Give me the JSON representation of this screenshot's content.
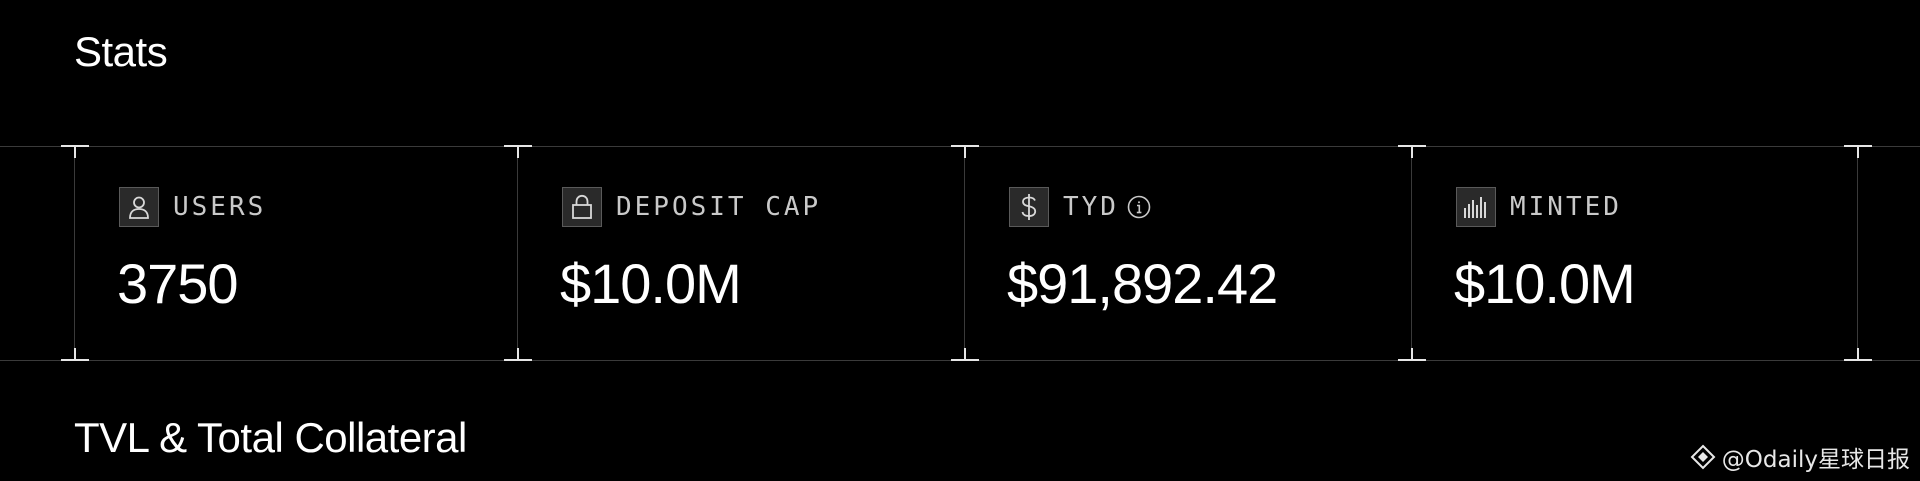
{
  "stats_section": {
    "title": "Stats",
    "cards": [
      {
        "icon": "user-icon",
        "label": "USERS",
        "value": "3750"
      },
      {
        "icon": "lock-icon",
        "label": "DEPOSIT CAP",
        "value": "$10.0M"
      },
      {
        "icon": "dollar-icon",
        "label": "TYD",
        "info_icon": "info-icon",
        "value": "$91,892.42"
      },
      {
        "icon": "bar-chart-icon",
        "label": "MINTED",
        "value": "$10.0M"
      }
    ]
  },
  "tvl_section": {
    "title": "TVL & Total Collateral"
  },
  "watermark": {
    "icon": "odaily-logo-icon",
    "text": "@Odaily星球日报"
  },
  "colors": {
    "background": "#000000",
    "text_primary": "#ffffff",
    "text_label": "#c9c9c9",
    "divider": "#3a3a3a",
    "icon_box_bg": "#2a2a2a"
  }
}
